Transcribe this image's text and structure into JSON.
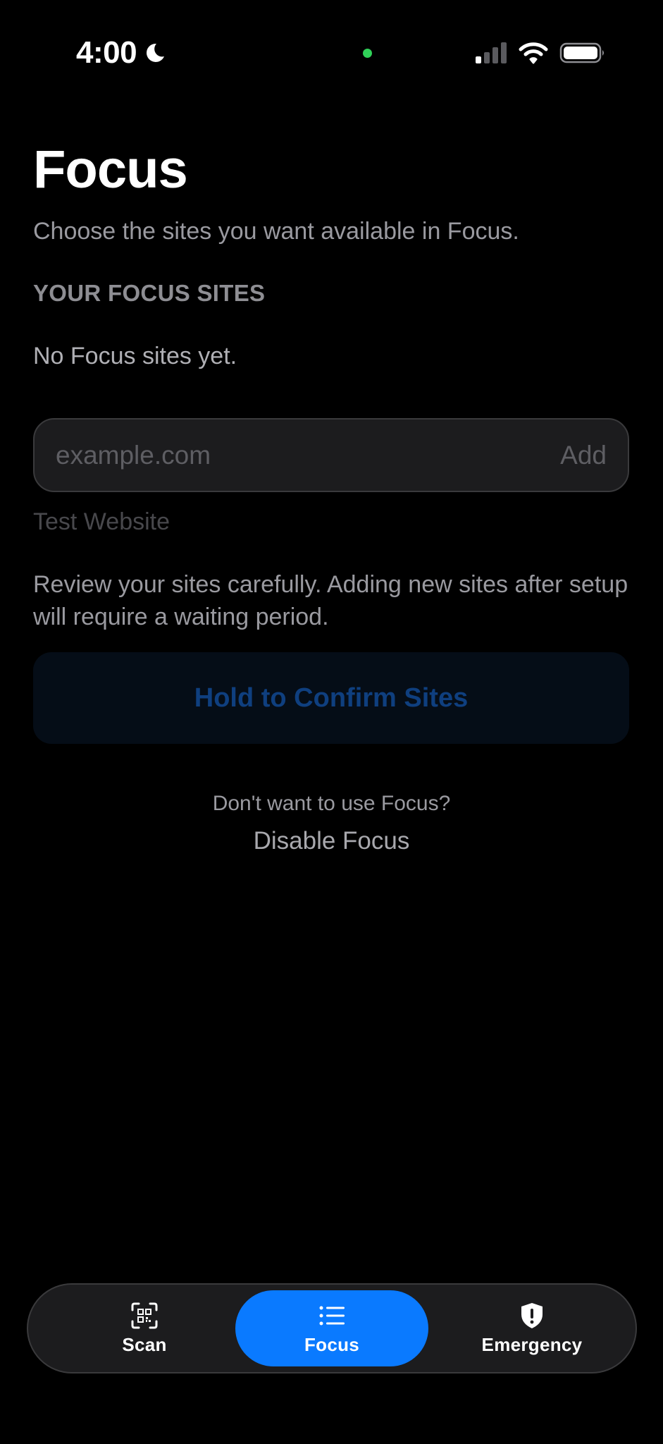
{
  "status_bar": {
    "time": "4:00",
    "icons": [
      "moon-icon",
      "camera-indicator-dot",
      "cellular-signal-icon",
      "wifi-icon",
      "battery-icon"
    ],
    "indicator_color": "#30d158"
  },
  "page": {
    "title": "Focus",
    "subtitle": "Choose the sites you want available in Focus."
  },
  "focus_sites": {
    "header": "YOUR FOCUS SITES",
    "empty_text": "No Focus sites yet.",
    "input_placeholder": "example.com",
    "input_value": "",
    "add_label": "Add",
    "suggestion": "Test Website"
  },
  "notice": "Review your sites carefully. Adding new sites after setup will require a waiting period.",
  "confirm_button_label": "Hold to Confirm Sites",
  "disable": {
    "prompt": "Don't want to use Focus?",
    "link_label": "Disable Focus"
  },
  "tab_bar": {
    "active_color": "#0a7aff",
    "tabs": [
      {
        "label": "Scan",
        "icon": "qr-scan-icon",
        "active": false
      },
      {
        "label": "Focus",
        "icon": "list-icon",
        "active": true
      },
      {
        "label": "Emergency",
        "icon": "shield-alert-icon",
        "active": false
      }
    ]
  }
}
